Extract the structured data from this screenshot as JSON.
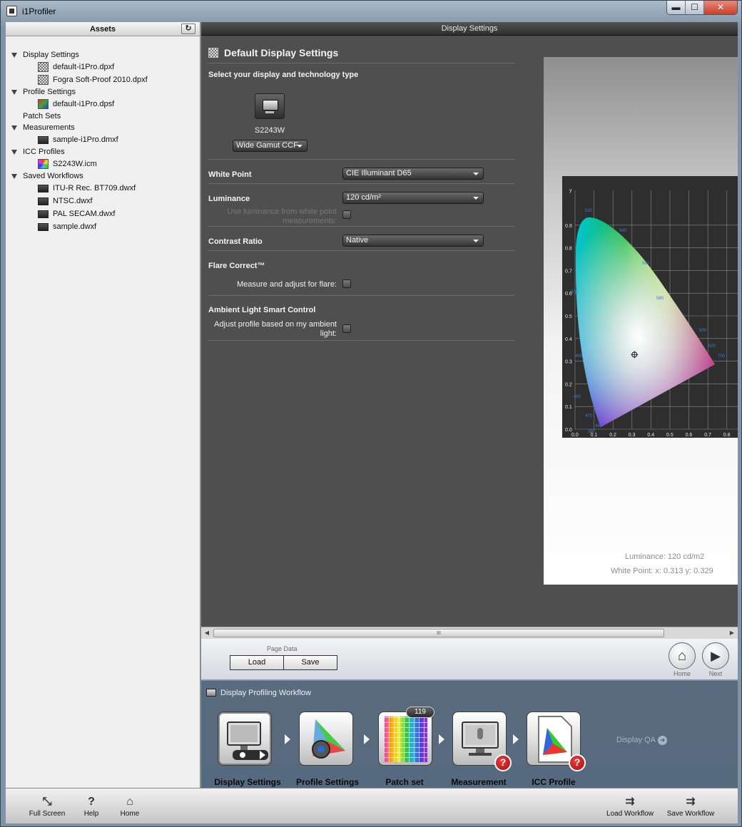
{
  "window": {
    "title": "i1Profiler",
    "controls": {
      "minimize": "▬",
      "maximize": "☐",
      "close": "✕"
    }
  },
  "assets": {
    "title": "Assets",
    "refresh_icon": "↻",
    "groups": [
      {
        "label": "Display Settings",
        "items": [
          "default-i1Pro.dpxf",
          "Fogra Soft-Proof 2010.dpxf"
        ]
      },
      {
        "label": "Profile Settings",
        "items": [
          "default-i1Pro.dpsf"
        ]
      },
      {
        "label": "Patch Sets",
        "items": []
      },
      {
        "label": "Measurements",
        "items": [
          "sample-i1Pro.dmxf"
        ]
      },
      {
        "label": "ICC Profiles",
        "items": [
          "S2243W.icm"
        ]
      },
      {
        "label": "Saved Workflows",
        "items": [
          "ITU-R Rec. BT709.dwxf",
          "NTSC.dwxf",
          "PAL SECAM.dwxf",
          "sample.dwxf"
        ]
      }
    ]
  },
  "main": {
    "header": "Display Settings",
    "section_title": "Default Display Settings",
    "select_label": "Select your display and technology type",
    "display_name": "S2243W",
    "technology": "Wide Gamut CCF",
    "white_point": {
      "label": "White Point",
      "value": "CIE Illuminant D65"
    },
    "luminance": {
      "label": "Luminance",
      "value": "120 cd/m²",
      "checkbox_label": "Use luminance from white point measurements:"
    },
    "contrast": {
      "label": "Contrast Ratio",
      "value": "Native"
    },
    "flare": {
      "label": "Flare Correct™",
      "checkbox_label": "Measure and adjust for flare:"
    },
    "ambient": {
      "label": "Ambient Light Smart Control",
      "checkbox_label": "Adjust profile based on my ambient light:"
    }
  },
  "preview": {
    "luminance_text": "Luminance:   120 cd/m2",
    "whitepoint_text": "White Point: x: 0.313  y: 0.329",
    "cie": {
      "y_label": "y",
      "y_ticks": [
        "0.0",
        "0.1",
        "0.2",
        "0.3",
        "0.4",
        "0.5",
        "0.6",
        "0.7",
        "0.8",
        "0.9"
      ],
      "x_ticks": [
        "0.0",
        "0.1",
        "0.2",
        "0.3",
        "0.4",
        "0.5",
        "0.6",
        "0.7",
        "0.8"
      ],
      "wavelengths": [
        "520",
        "540",
        "560",
        "580",
        "600",
        "620",
        "700",
        "500",
        "490",
        "480",
        "470",
        "460",
        "380"
      ],
      "white_point": {
        "x": 0.313,
        "y": 0.329
      }
    }
  },
  "page_data": {
    "label": "Page Data",
    "load": "Load",
    "save": "Save"
  },
  "nav": {
    "home_label": "Home",
    "next_label": "Next",
    "home_icon": "⌂",
    "next_icon": "▶"
  },
  "workflow": {
    "title": "Display Profiling Workflow",
    "steps": [
      "Display Settings",
      "Profile Settings",
      "Patch set",
      "Measurement",
      "ICC Profile"
    ],
    "patch_count": "119",
    "qa_label": "Display QA",
    "qa_icon": "➔",
    "error_icon": "?"
  },
  "toolbar": {
    "full_screen": "Full Screen",
    "help": "Help",
    "home": "Home",
    "load_workflow": "Load Workflow",
    "save_workflow": "Save Workflow",
    "icons": {
      "full_screen": "⤡",
      "help": "?",
      "home": "⌂",
      "load": "⇉",
      "save": "⇉"
    }
  },
  "scrollbar": {
    "grip": "III"
  },
  "colors": {
    "panel_dark": "#4f4f4f",
    "workflow_bg": "#596b7e",
    "accent_red": "#c8402a"
  }
}
